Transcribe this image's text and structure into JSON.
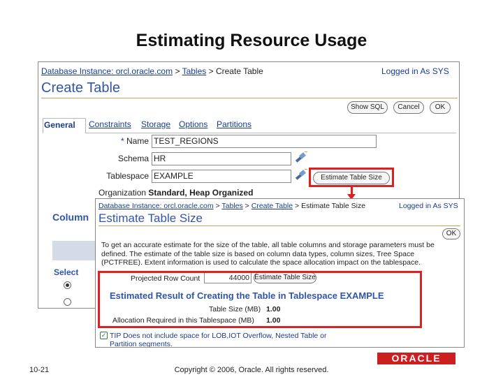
{
  "slide": {
    "title": "Estimating Resource Usage",
    "page_number": "10-21",
    "copyright": "Copyright © 2006, Oracle. All rights reserved.",
    "logo": "ORACLE"
  },
  "create_table": {
    "breadcrumb": {
      "instance": "Database Instance: orcl.oracle.com",
      "sep1": ">",
      "tables": "Tables",
      "sep2": ">",
      "current": "Create Table"
    },
    "logged_in": "Logged in As SYS",
    "heading": "Create Table",
    "buttons": {
      "show_sql": "Show SQL",
      "cancel": "Cancel",
      "ok": "OK"
    },
    "tabs": [
      "General",
      "Constraints",
      "Storage",
      "Options",
      "Partitions"
    ],
    "fields": {
      "name_label": "Name",
      "name_required": "*",
      "name_value": "TEST_REGIONS",
      "schema_label": "Schema",
      "schema_value": "HR",
      "tablespace_label": "Tablespace",
      "tablespace_value": "EXAMPLE",
      "organization_label": "Organization",
      "organization_value": "Standard, Heap Organized"
    },
    "estimate_button": "Estimate Table Size",
    "columns_heading": "Column",
    "select_header": "Select"
  },
  "estimate": {
    "breadcrumb": {
      "instance": "Database Instance: orcl.oracle.com",
      "sep1": ">",
      "tables": "Tables",
      "sep2": ">",
      "create": "Create Table",
      "sep3": ">",
      "current": "Estimate Table Size"
    },
    "logged_in": "Logged in As SYS",
    "heading": "Estimate Table Size",
    "ok_button": "OK",
    "description": [
      "To get an accurate estimate for the size of the table, all table columns and storage parameters must be",
      "defined. The estimate of the table size is based on column data types, column sizes, Tree Space",
      "(PCTFREE). Extent information is used to calculate the space allocation impact on the tablespace."
    ],
    "row_count_label": "Projected Row Count",
    "row_count_value": "44000",
    "estimate_button": "Estimate Table Size",
    "result_title": "Estimated Result of Creating the Table in Tablespace EXAMPLE",
    "table_size_label": "Table Size (MB)",
    "table_size_value": "1.00",
    "allocation_label": "Allocation Required in this Tablespace (MB)",
    "allocation_value": "1.00",
    "tip": "TIP Does not include space for LOB,IOT Overflow, Nested Table or Partition segments."
  },
  "colors": {
    "highlight": "#e02020",
    "link": "#1a3c8c",
    "heading": "#3055a8",
    "oracle_red": "#cc1f1f"
  }
}
